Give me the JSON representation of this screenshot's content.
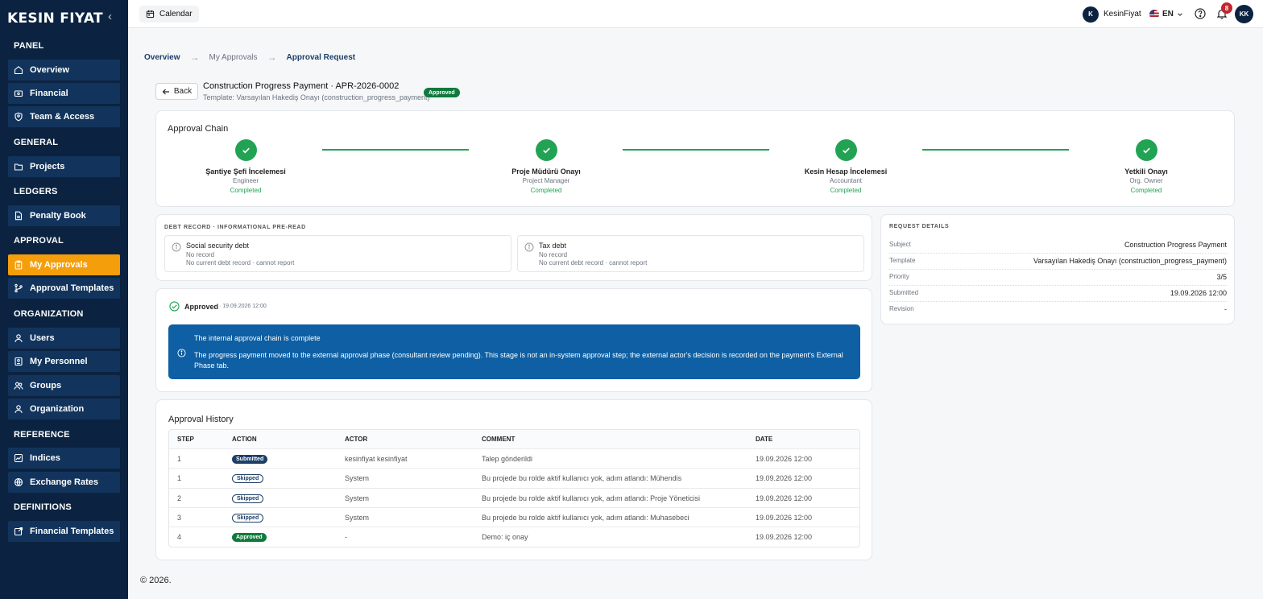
{
  "app": {
    "logo": "KESIN FIYAT"
  },
  "sidebar": {
    "sections": [
      {
        "title": "PANEL",
        "items": [
          {
            "label": "Overview"
          },
          {
            "label": "Financial"
          },
          {
            "label": "Team & Access"
          }
        ]
      },
      {
        "title": "GENERAL",
        "items": [
          {
            "label": "Projects"
          }
        ]
      },
      {
        "title": "LEDGERS",
        "items": [
          {
            "label": "Penalty Book"
          }
        ]
      },
      {
        "title": "APPROVAL",
        "items": [
          {
            "label": "My Approvals"
          },
          {
            "label": "Approval Templates"
          }
        ]
      },
      {
        "title": "ORGANIZATION",
        "items": [
          {
            "label": "Users"
          },
          {
            "label": "My Personnel"
          },
          {
            "label": "Groups"
          },
          {
            "label": "Organization"
          }
        ]
      },
      {
        "title": "REFERENCE",
        "items": [
          {
            "label": "Indices"
          },
          {
            "label": "Exchange Rates"
          }
        ]
      },
      {
        "title": "DEFINITIONS",
        "items": [
          {
            "label": "Financial Templates"
          }
        ]
      }
    ],
    "active_item": "My Approvals"
  },
  "topbar": {
    "calendar_label": "Calendar",
    "user_initial": "K",
    "user_name": "KesinFiyat",
    "language": "EN",
    "notification_count": "8",
    "account_initials": "KK"
  },
  "breadcrumb": [
    "Overview",
    "My Approvals",
    "Approval Request"
  ],
  "request": {
    "back_label": "Back",
    "title": "Construction Progress Payment · APR-2026-0002",
    "template_line": "Template: Varsayılan Hakediş Onayı (construction_progress_payment)",
    "status": "Approved"
  },
  "approval_chain": {
    "title": "Approval Chain",
    "steps": [
      {
        "name": "Şantiye Şefi İncelemesi",
        "role": "Engineer",
        "status": "Completed"
      },
      {
        "name": "Proje Müdürü Onayı",
        "role": "Project Manager",
        "status": "Completed"
      },
      {
        "name": "Kesin Hesap İncelemesi",
        "role": "Accountant",
        "status": "Completed"
      },
      {
        "name": "Yetkili Onayı",
        "role": "Org. Owner",
        "status": "Completed"
      }
    ],
    "completed_color": "#22a354"
  },
  "debt_record": {
    "title": "DEBT RECORD · INFORMATIONAL PRE-READ",
    "items": [
      {
        "title": "Social security debt",
        "status": "No record",
        "note": "No current debt record · cannot report"
      },
      {
        "title": "Tax debt",
        "status": "No record",
        "note": "No current debt record · cannot report"
      }
    ]
  },
  "decision": {
    "label": "Approved",
    "date": "· 19.09.2026 12:00",
    "info_title": "The internal approval chain is complete",
    "info_body": "The progress payment moved to the external approval phase (consultant review pending). This stage is not an in-system approval step; the external actor's decision is recorded on the payment's External Phase tab."
  },
  "request_details": {
    "title": "REQUEST DETAILS",
    "rows": [
      {
        "key": "Subject",
        "value": "Construction Progress Payment"
      },
      {
        "key": "Template",
        "value": "Varsayılan Hakediş Onayı (construction_progress_payment)"
      },
      {
        "key": "Priority",
        "value": "3/5"
      },
      {
        "key": "Submitted",
        "value": "19.09.2026 12:00"
      },
      {
        "key": "Revision",
        "value": "-"
      }
    ]
  },
  "history": {
    "title": "Approval History",
    "columns": [
      "STEP",
      "ACTION",
      "ACTOR",
      "COMMENT",
      "DATE"
    ],
    "rows": [
      {
        "step": "1",
        "action": "Submitted",
        "action_type": "sub",
        "actor": "kesinfiyat kesinfiyat",
        "comment": "Talep gönderildi",
        "date": "19.09.2026 12:00"
      },
      {
        "step": "1",
        "action": "Skipped",
        "action_type": "skip",
        "actor": "System",
        "comment": "Bu projede bu rolde aktif kullanıcı yok, adım atlandı: Mühendis",
        "date": "19.09.2026 12:00"
      },
      {
        "step": "2",
        "action": "Skipped",
        "action_type": "skip",
        "actor": "System",
        "comment": "Bu projede bu rolde aktif kullanıcı yok, adım atlandı: Proje Yöneticisi",
        "date": "19.09.2026 12:00"
      },
      {
        "step": "3",
        "action": "Skipped",
        "action_type": "skip",
        "actor": "System",
        "comment": "Bu projede bu rolde aktif kullanıcı yok, adım atlandı: Muhasebeci",
        "date": "19.09.2026 12:00"
      },
      {
        "step": "4",
        "action": "Approved",
        "action_type": "appr",
        "actor": "-",
        "comment": "Demo: iç onay",
        "date": "19.09.2026 12:00"
      }
    ]
  },
  "footer": "© 2026."
}
